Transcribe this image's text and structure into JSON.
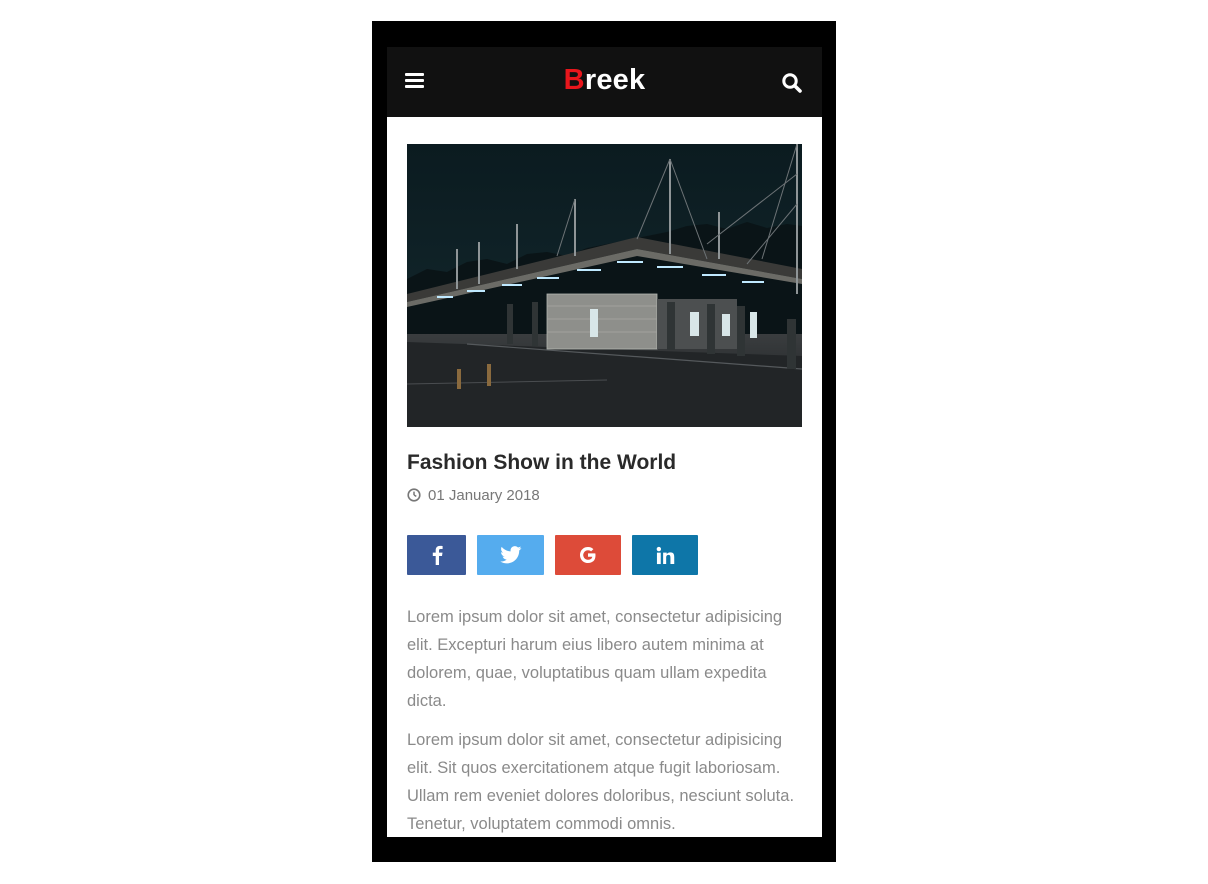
{
  "header": {
    "logo_first_letter": "B",
    "logo_rest": "reek",
    "icons": {
      "menu": "hamburger-menu-icon",
      "search": "search-icon"
    }
  },
  "post": {
    "image": "bus-station-at-night-photo",
    "title": "Fashion Show in the World",
    "date": "01 January 2018",
    "share": [
      {
        "network": "facebook",
        "icon": "facebook-icon",
        "color": "#3b5998"
      },
      {
        "network": "twitter",
        "icon": "twitter-icon",
        "color": "#55acee"
      },
      {
        "network": "google",
        "icon": "google-icon",
        "color": "#dd4b39"
      },
      {
        "network": "linkedin",
        "icon": "linkedin-icon",
        "color": "#0e76a8"
      }
    ],
    "paragraphs": [
      "Lorem ipsum dolor sit amet, consectetur adipisicing elit. Excepturi harum eius libero autem minima at dolorem, quae, voluptatibus quam ullam expedita dicta.",
      "Lorem ipsum dolor sit amet, consectetur adipisicing elit. Sit quos exercitationem atque fugit laboriosam. Ullam rem eveniet dolores doloribus, nesciunt soluta. Tenetur, voluptatem commodi omnis."
    ]
  },
  "colors": {
    "logo_accent": "#e8161c",
    "appbar": "#111111",
    "device_frame": "#000000"
  }
}
